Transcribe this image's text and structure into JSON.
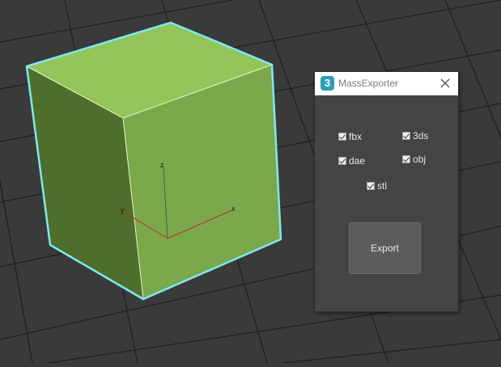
{
  "viewport": {
    "axis_labels": {
      "z": "z",
      "y": "y",
      "x": "x"
    },
    "colors": {
      "background": "#3a3a3a",
      "grid": "#1f1f1f",
      "cube_top": "#93c55a",
      "cube_right": "#7aa84a",
      "cube_left": "#4f6f2a",
      "selection_outline": "#7fe8f0"
    }
  },
  "dialog": {
    "icon_label": "3",
    "title": "MassExporter",
    "close_icon": "close-icon",
    "formats": [
      {
        "label": "fbx",
        "checked": true
      },
      {
        "label": "3ds",
        "checked": true
      },
      {
        "label": "dae",
        "checked": true
      },
      {
        "label": "obj",
        "checked": true
      },
      {
        "label": "stl",
        "checked": true
      }
    ],
    "export_label": "Export"
  }
}
